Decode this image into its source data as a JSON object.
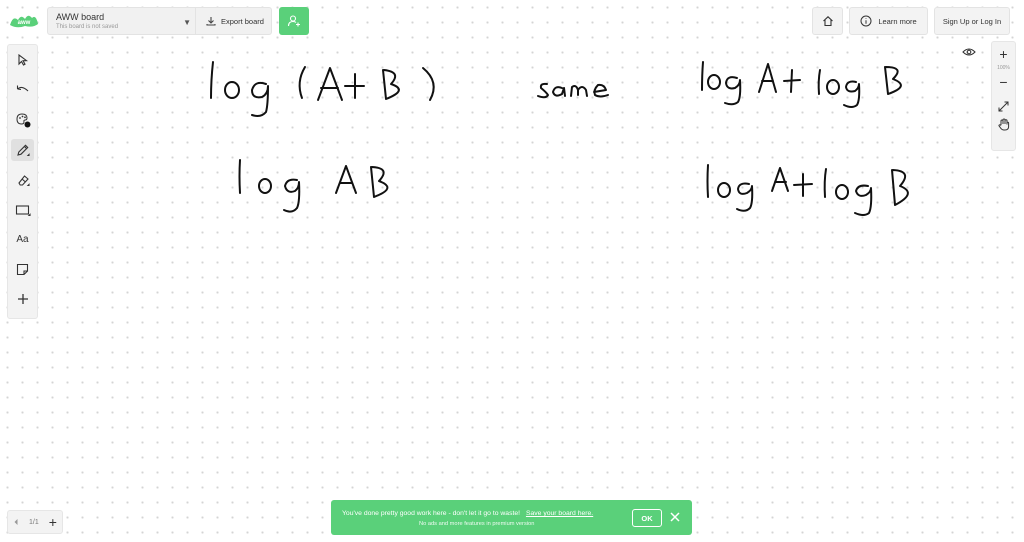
{
  "app": {
    "logo_icon": "aww-logo",
    "brand_color": "#5ad07a"
  },
  "board": {
    "name": "AWW board",
    "status": "This board is not saved",
    "export_label": "Export board"
  },
  "header_right": {
    "learn_more_label": "Learn more",
    "signup_label": "Sign Up or Log In"
  },
  "tools": [
    "select-icon",
    "undo-icon",
    "color-palette-icon",
    "pen-icon",
    "eraser-icon",
    "shape-rectangle-icon",
    "text-tool",
    "sticky-note-icon",
    "add-icon"
  ],
  "text_tool_label": "Aa",
  "zoom": {
    "plus": "+",
    "level": "100%",
    "minus": "−"
  },
  "pages": {
    "indicator": "1/1",
    "add": "+"
  },
  "banner": {
    "message": "You've done pretty good work here - don't let it go to waste!",
    "link": "Save your board here.",
    "sub": "No ads and more features in premium version",
    "ok_label": "OK"
  },
  "canvas": {
    "strokes_description": [
      "log (A+B)",
      "same",
      "log A + log B",
      "log AB",
      "log A+log B"
    ]
  }
}
